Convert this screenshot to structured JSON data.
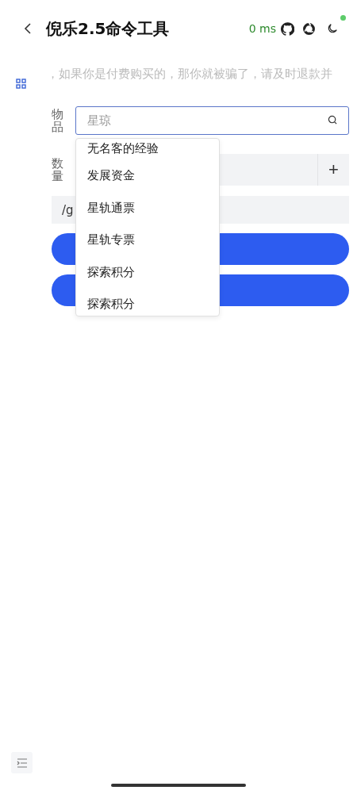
{
  "header": {
    "title": "倪乐2.5命令工具",
    "latency": "0 ms"
  },
  "notice": "，如果你是付费购买的，那你就被骗了，请及时退款并",
  "form": {
    "item_label": "物品",
    "item_placeholder": "星琼",
    "quantity_label": "数量",
    "quantity_plus": "+",
    "command": "/g"
  },
  "dropdown": {
    "options": [
      {
        "label": "无名客的经验"
      },
      {
        "label": "发展资金"
      },
      {
        "label": "星轨通票"
      },
      {
        "label": "星轨专票"
      },
      {
        "label": "探索积分"
      },
      {
        "label": "探索积分"
      }
    ]
  }
}
